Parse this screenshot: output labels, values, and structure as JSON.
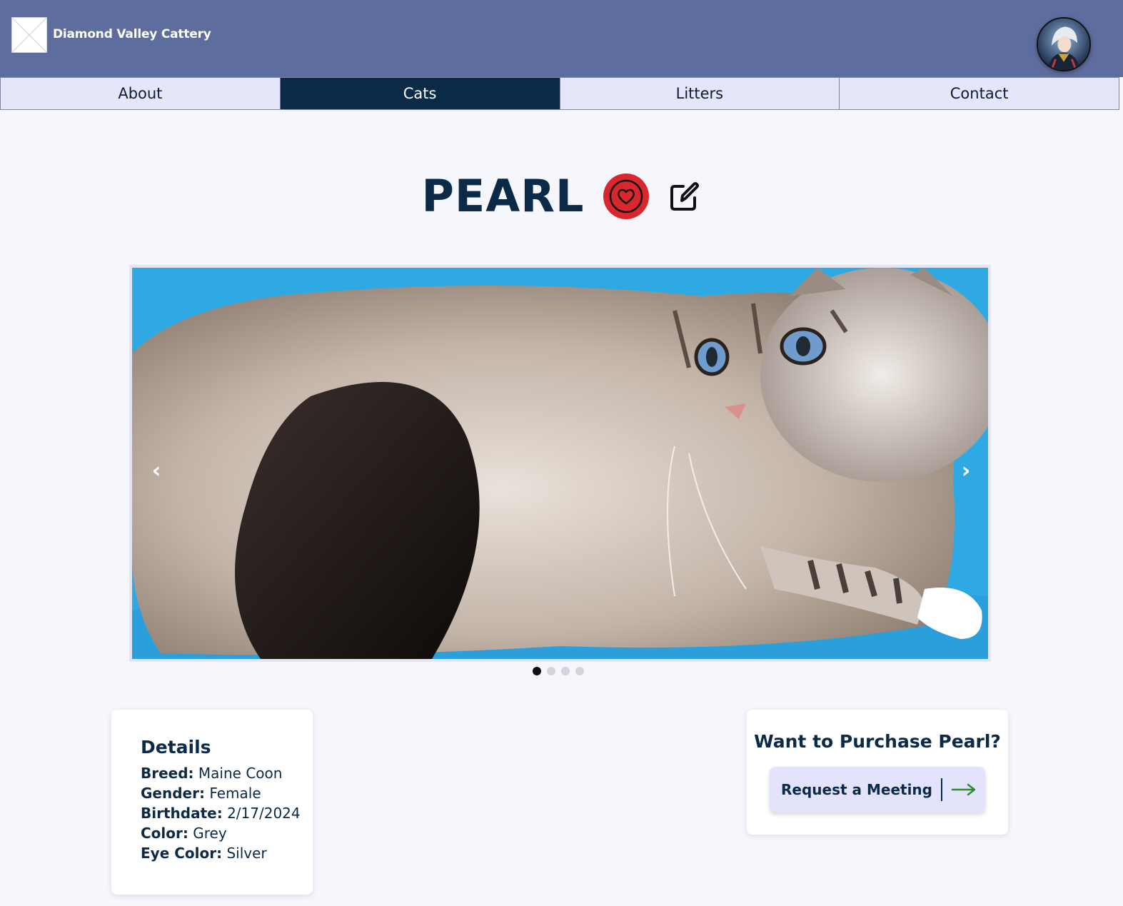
{
  "header": {
    "site_title": "Diamond Valley Cattery",
    "logo_icon": "broken-image-icon",
    "avatar_icon": "user-avatar"
  },
  "nav": {
    "tabs": [
      {
        "label": "About",
        "active": false
      },
      {
        "label": "Cats",
        "active": true
      },
      {
        "label": "Litters",
        "active": false
      },
      {
        "label": "Contact",
        "active": false
      }
    ]
  },
  "cat": {
    "name": "PEARL",
    "favorite_icon": "heart-icon",
    "edit_icon": "edit-icon"
  },
  "carousel": {
    "prev_icon": "chevron-left-icon",
    "next_icon": "chevron-right-icon",
    "prev_glyph": "‹",
    "next_glyph": "›",
    "slide_count": 4,
    "active_slide": 1
  },
  "details": {
    "title": "Details",
    "rows": [
      {
        "label": "Breed:",
        "value": "Maine Coon"
      },
      {
        "label": "Gender:",
        "value": "Female"
      },
      {
        "label": "Birthdate:",
        "value": "2/17/2024"
      },
      {
        "label": "Color:",
        "value": "Grey"
      },
      {
        "label": "Eye Color:",
        "value": "Silver"
      }
    ]
  },
  "purchase": {
    "title": "Want to Purchase Pearl?",
    "button_label": "Request a Meeting",
    "button_icon": "arrow-right-icon"
  },
  "colors": {
    "header_bg": "#5d6d9e",
    "nav_active_bg": "#0b2a47",
    "nav_bg": "#e6e6fb",
    "favorite_red": "#d9272e",
    "arrow_green": "#2e8b2e",
    "text_navy": "#0b2a47"
  }
}
